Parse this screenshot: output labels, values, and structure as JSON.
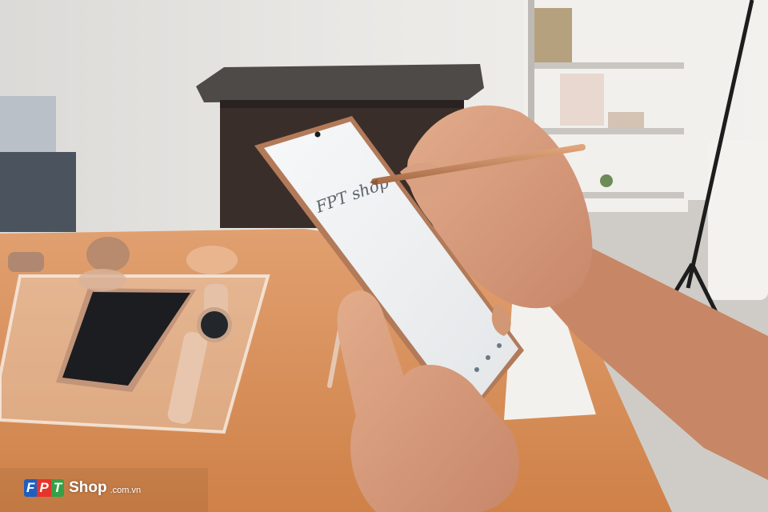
{
  "photo": {
    "subject": "hand-writing-on-phone-with-stylus",
    "colors": {
      "wall": "#e7e5e2",
      "table": "#d98d55",
      "phone_frame": "#b07a58",
      "screen": "#f3f4f5",
      "stylus": "#c98a5f",
      "skin": "#d69a78",
      "cabinet": "#3b2f2b"
    }
  },
  "screen": {
    "handwriting": "FPT shop"
  },
  "watermark": {
    "letters": [
      "F",
      "P",
      "T"
    ],
    "shop": "Shop",
    "domain": ".com.vn"
  }
}
